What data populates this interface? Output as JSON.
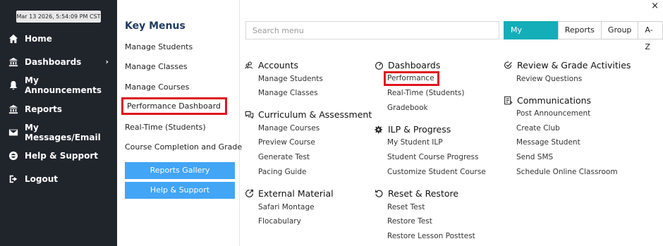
{
  "datetime": "Mar 13 2026, 5:54:09 PM CST",
  "sidebar": {
    "items": [
      {
        "label": "Home",
        "icon": "home-icon"
      },
      {
        "label": "Dashboards",
        "icon": "bank-icon"
      },
      {
        "label": "My Announcements",
        "icon": "bell-icon"
      },
      {
        "label": "Reports",
        "icon": "bank-icon"
      },
      {
        "label": "My Messages/Email",
        "icon": "envelope-icon"
      },
      {
        "label": "Help & Support",
        "icon": "lifebuoy-icon"
      },
      {
        "label": "Logout",
        "icon": "sign-out-icon"
      }
    ]
  },
  "key_menus": {
    "title": "Key Menus",
    "items": [
      "Manage Students",
      "Manage Classes",
      "Manage Courses",
      "Performance Dashboard",
      "Real-Time (Students)",
      "Course Completion and Grade"
    ],
    "buttons": [
      "Reports Gallery",
      "Help & Support"
    ]
  },
  "search": {
    "placeholder": "Search menu"
  },
  "tabs": [
    "My Activities",
    "Reports",
    "Group",
    "A-Z"
  ],
  "close_label": "×",
  "sections": {
    "accounts": {
      "title": "Accounts",
      "links": [
        "Manage Students",
        "Manage Classes"
      ]
    },
    "curriculum": {
      "title": "Curriculum & Assessment",
      "links": [
        "Manage Courses",
        "Preview Course",
        "Generate Test",
        "Pacing Guide"
      ]
    },
    "external": {
      "title": "External Material",
      "links": [
        "Safari Montage",
        "Flocabulary"
      ]
    },
    "dashboards": {
      "title": "Dashboards",
      "links": [
        "Performance",
        "Real-Time (Students)",
        "Gradebook"
      ]
    },
    "ilp": {
      "title": "ILP & Progress",
      "links": [
        "My Student ILP",
        "Student Course Progress",
        "Customize Student Course"
      ]
    },
    "reset": {
      "title": "Reset & Restore",
      "links": [
        "Reset Test",
        "Restore Test",
        "Restore Lesson Posttest"
      ]
    },
    "review": {
      "title": "Review & Grade Activities",
      "links": [
        "Review Questions"
      ]
    },
    "communications": {
      "title": "Communications",
      "links": [
        "Post Announcement",
        "Create Club",
        "Message Student",
        "Send SMS",
        "Schedule Online Classroom"
      ]
    }
  },
  "colors": {
    "sidebar_bg": "#20242b",
    "accent_teal": "#14aeb8",
    "button_blue": "#42a5f5",
    "highlight_red": "#e0141e"
  }
}
